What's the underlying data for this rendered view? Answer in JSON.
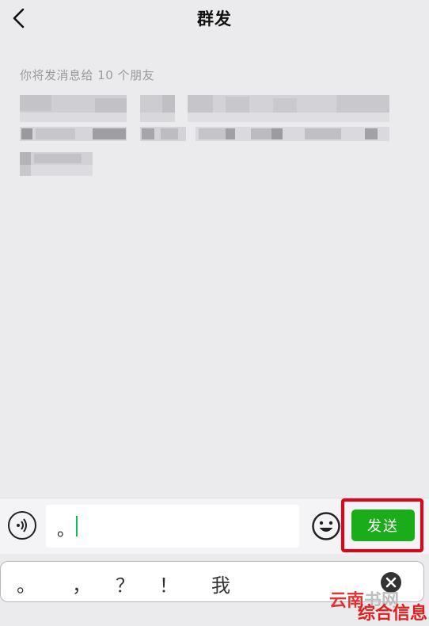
{
  "header": {
    "title": "群发",
    "back_icon": "chevron-left-icon"
  },
  "main": {
    "recipients_caption": "你将发消息给 10 个朋友"
  },
  "input_bar": {
    "voice_icon": "voice-icon",
    "message_text": "。",
    "emoji_icon": "emoji-icon",
    "send_label": "发送",
    "highlight_color": "#e60012",
    "send_color": "#1aad19"
  },
  "suggestions": {
    "items": [
      "。",
      "，",
      "？",
      "！",
      "我"
    ],
    "clear_icon": "clear-icon"
  },
  "watermark": {
    "line1_a": "云南",
    "line1_b": "书网",
    "line2": "综合信息"
  }
}
